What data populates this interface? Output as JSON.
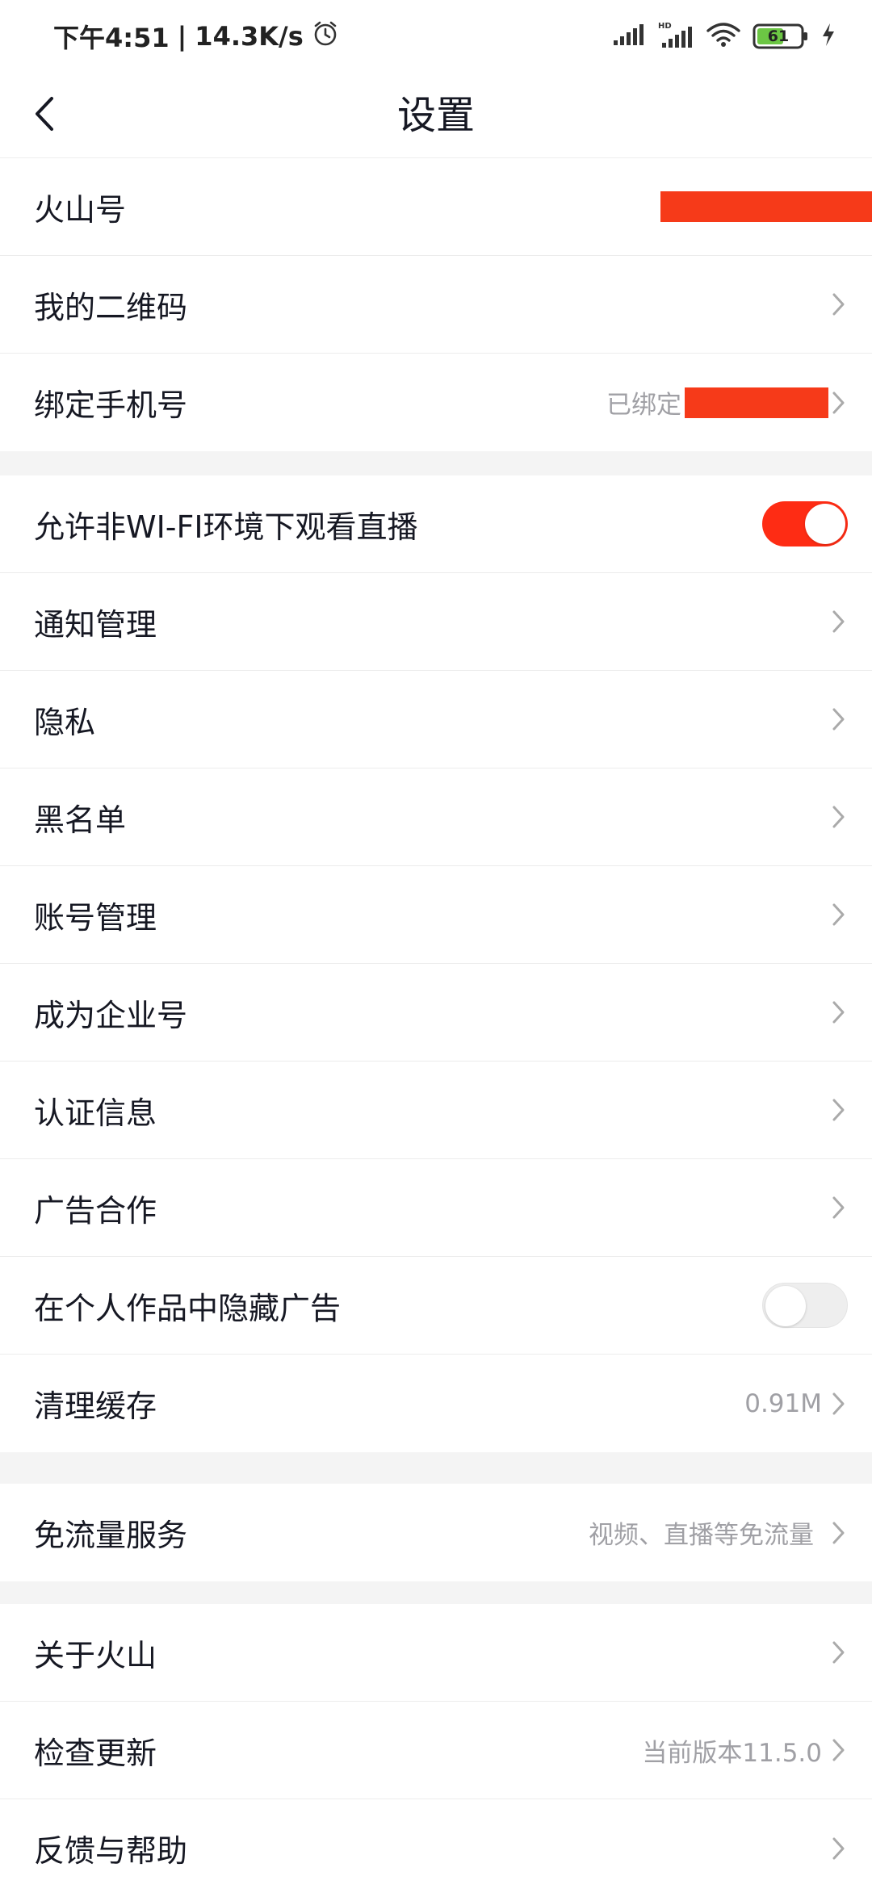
{
  "status_bar": {
    "time": "下午4:51",
    "network_speed": "14.3K/s",
    "battery_level": "61",
    "icons": [
      "alarm-icon",
      "signal-icon",
      "hd-signal-icon",
      "wifi-icon",
      "battery-icon",
      "charging-icon"
    ]
  },
  "navbar": {
    "title": "设置",
    "back_icon": "back-arrow-icon"
  },
  "groups": [
    {
      "items": [
        {
          "label": "火山号",
          "value": "",
          "redacted": true
        },
        {
          "label": "我的二维码",
          "value": ""
        },
        {
          "label": "绑定手机号",
          "value": "已绑定",
          "redacted": true
        }
      ]
    },
    {
      "items": [
        {
          "label": "允许非WI-FI环境下观看直播",
          "toggle": "on"
        },
        {
          "label": "通知管理"
        },
        {
          "label": "隐私"
        },
        {
          "label": "黑名单"
        },
        {
          "label": "账号管理"
        },
        {
          "label": "成为企业号"
        },
        {
          "label": "认证信息"
        },
        {
          "label": "广告合作"
        },
        {
          "label": "在个人作品中隐藏广告",
          "toggle": "off"
        },
        {
          "label": "清理缓存",
          "value": "0.91M"
        }
      ]
    },
    {
      "items": [
        {
          "label": "免流量服务",
          "value": "视频、直播等免流量"
        }
      ]
    },
    {
      "items": [
        {
          "label": "关于火山"
        },
        {
          "label": "检查更新",
          "value": "当前版本11.5.0"
        },
        {
          "label": "反馈与帮助"
        }
      ]
    }
  ],
  "colors": {
    "accent": "#fe2c14",
    "redaction": "#f63a19",
    "battery_fill": "#6cc644",
    "separator_band": "#f4f4f4",
    "secondary_text": "#a0a0a5"
  }
}
